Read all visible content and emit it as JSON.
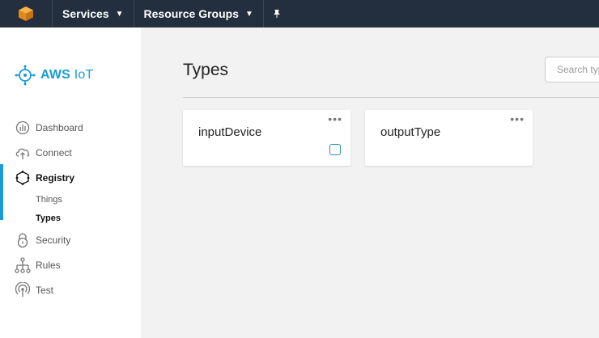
{
  "topbar": {
    "services_label": "Services",
    "resource_groups_label": "Resource Groups"
  },
  "sidebar": {
    "brand_primary": "AWS",
    "brand_secondary": "IoT",
    "items": [
      {
        "label": "Dashboard",
        "icon": "dashboard-gauge-icon"
      },
      {
        "label": "Connect",
        "icon": "cloud-upload-icon"
      },
      {
        "label": "Registry",
        "icon": "registry-hexagon-icon",
        "active": true,
        "children": [
          {
            "label": "Things"
          },
          {
            "label": "Types",
            "active": true
          }
        ]
      },
      {
        "label": "Security",
        "icon": "padlock-icon"
      },
      {
        "label": "Rules",
        "icon": "hierarchy-icon"
      },
      {
        "label": "Test",
        "icon": "broadcast-icon"
      }
    ]
  },
  "main": {
    "title": "Types",
    "search_placeholder": "Search types",
    "cards": [
      {
        "name": "inputDevice",
        "more": "•••"
      },
      {
        "name": "outputType",
        "more": "•••"
      }
    ]
  },
  "colors": {
    "topbar_bg": "#232f3e",
    "accent": "#1a9bd7",
    "aws_orange": "#f29b1d"
  }
}
